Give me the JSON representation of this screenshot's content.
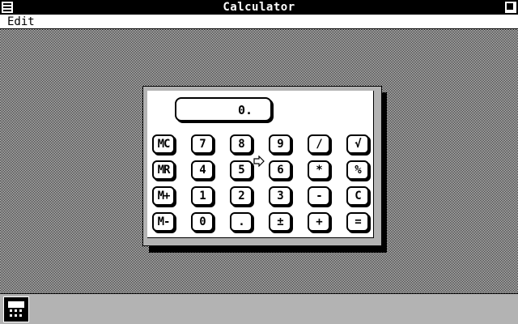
{
  "window": {
    "title": "Calculator"
  },
  "menu": {
    "items": [
      {
        "label": "Edit"
      }
    ]
  },
  "display": {
    "value": "0."
  },
  "keys": [
    [
      "MC",
      "7",
      "8",
      "9",
      "/",
      "√"
    ],
    [
      "MR",
      "4",
      "5",
      "6",
      "*",
      "%"
    ],
    [
      "M+",
      "1",
      "2",
      "3",
      "-",
      "C"
    ],
    [
      "M-",
      "0",
      ".",
      "±",
      "+",
      "="
    ]
  ],
  "icons": {
    "system_menu": "system-menu-icon",
    "size_box": "maximize-icon",
    "minimized_app": "calculator-icon",
    "pointer": "arrow-cursor-icon"
  },
  "colors": {
    "foreground": "#000000",
    "background": "#ffffff"
  }
}
